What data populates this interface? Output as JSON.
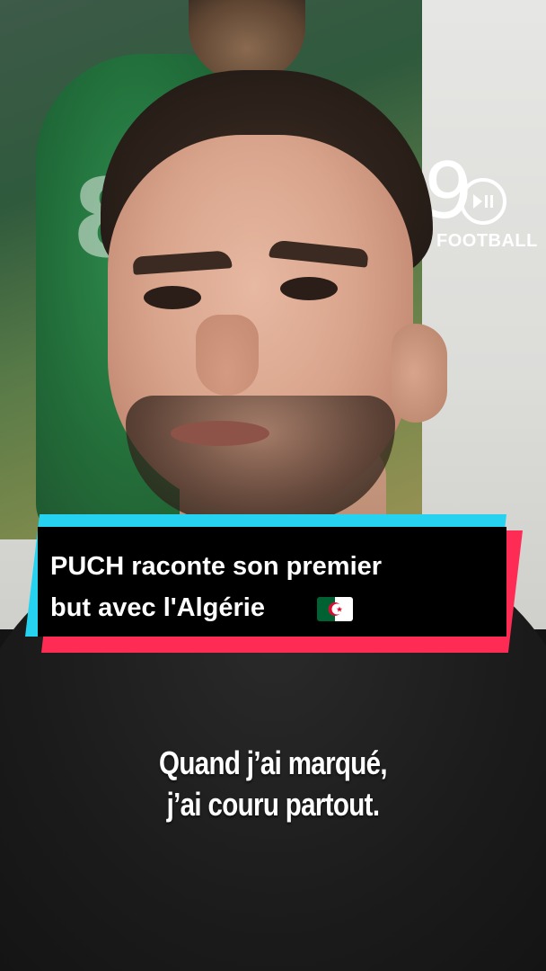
{
  "logo": {
    "number": "9",
    "play_symbol": "▶||",
    "wordmark": "FOOTBALL"
  },
  "title_card": {
    "line1": "PUCH raconte son premier",
    "line2": "but avec l'Algérie",
    "flag_icon": "algeria-flag-icon",
    "colors": {
      "cyan": "#25d3f0",
      "red": "#fe2c55",
      "black": "#000000"
    }
  },
  "subtitles": {
    "line1": "Quand j’ai marqué,",
    "line2": "j’ai couru partout."
  }
}
